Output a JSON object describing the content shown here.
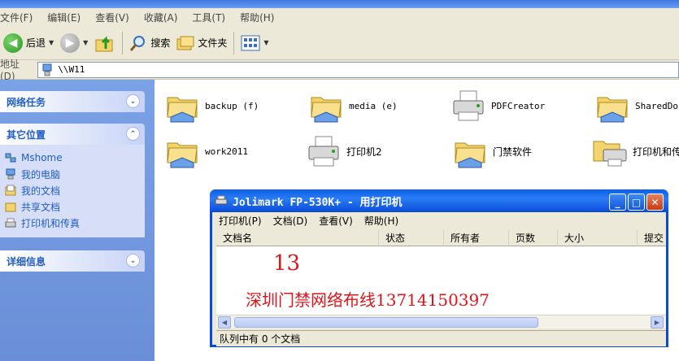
{
  "menubar": {
    "items": [
      "文件(F)",
      "编辑(E)",
      "查看(V)",
      "收藏(A)",
      "工具(T)",
      "帮助(H)"
    ]
  },
  "toolbar": {
    "back_label": "后退",
    "search_label": "搜索",
    "folders_label": "文件夹"
  },
  "address": {
    "label": "地址(D)",
    "value": "\\\\W11"
  },
  "left": {
    "network_tasks": "网络任务",
    "other_places": "其它位置",
    "places": [
      "Mshome",
      "我的电脑",
      "我的文档",
      "共享文档",
      "打印机和传真"
    ],
    "details": "详细信息"
  },
  "items": [
    "backup (f)",
    "media (e)",
    "PDFCreator",
    "SharedDocs",
    "work2011",
    "打印机2",
    "门禁软件",
    "打印机和传真"
  ],
  "printer_window": {
    "title": "Jolimark FP-530K+ - 用打印机",
    "menu": [
      "打印机(P)",
      "文档(D)",
      "查看(V)",
      "帮助(H)"
    ],
    "columns": [
      "文档名",
      "状态",
      "所有者",
      "页数",
      "大小",
      "提交"
    ],
    "status": "队列中有 0 个文档",
    "overlay_number": "13",
    "overlay_text": "深圳门禁网络布线13714150397"
  },
  "colors": {
    "accent": "#215dc6",
    "title_blue": "#0a4ad9",
    "overlay_red": "#e0141a"
  }
}
